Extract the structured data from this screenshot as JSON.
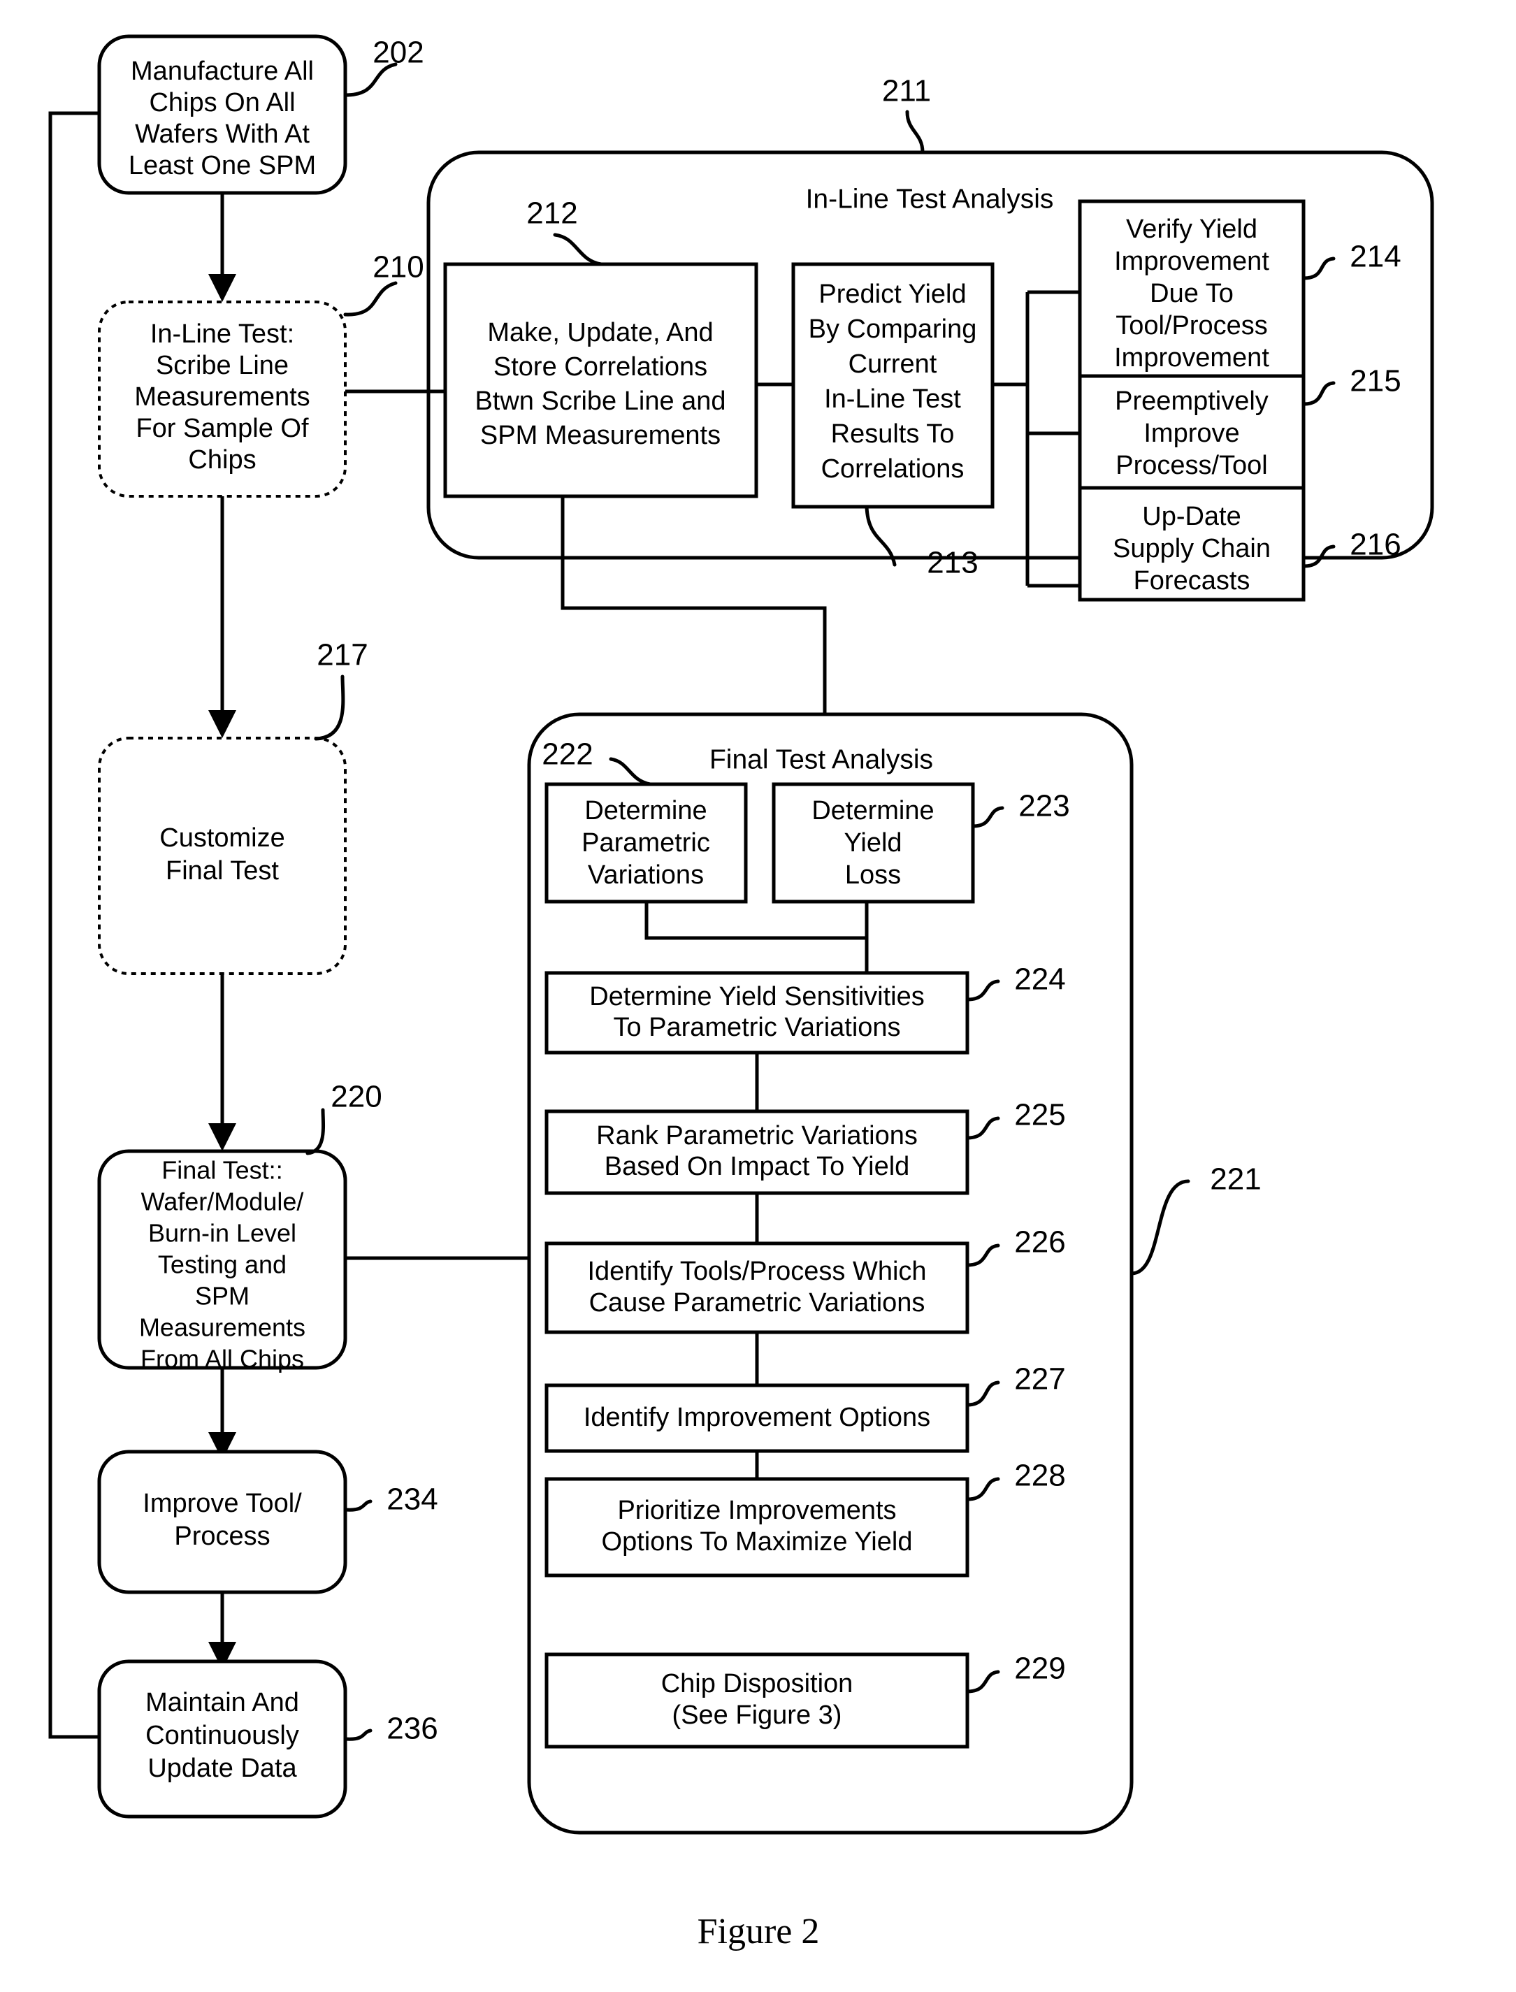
{
  "figure": {
    "caption": "Figure 2"
  },
  "process_boxes": {
    "manufacture": {
      "ref": "202",
      "lines": [
        "Manufacture All",
        "Chips On All",
        "Wafers With At",
        "Least One SPM"
      ]
    },
    "inline_test": {
      "ref": "210",
      "lines": [
        "In-Line Test:",
        "Scribe Line",
        "Measurements",
        "For Sample Of",
        "Chips"
      ]
    },
    "customize_final_test": {
      "ref": "217",
      "lines": [
        "Customize",
        "Final Test"
      ]
    },
    "final_test": {
      "ref": "220",
      "lines": [
        "Final Test::",
        "Wafer/Module/",
        "Burn-in Level",
        "Testing and",
        "SPM",
        "Measurements",
        "From All Chips"
      ]
    },
    "improve_tool_process": {
      "ref": "234",
      "lines": [
        "Improve Tool/",
        "Process"
      ]
    },
    "maintain_update_data": {
      "ref": "236",
      "lines": [
        "Maintain And",
        "Continuously",
        "Update Data"
      ]
    }
  },
  "inline_test_analysis": {
    "ref": "211",
    "title": "In-Line Test Analysis",
    "correlations": {
      "ref": "212",
      "lines": [
        "Make, Update, And",
        "Store Correlations",
        "Btwn Scribe Line and",
        "SPM Measurements"
      ]
    },
    "predict_yield": {
      "ref": "213",
      "lines": [
        "Predict Yield",
        "By Comparing",
        "Current",
        "In-Line Test",
        "Results To",
        "Correlations"
      ]
    },
    "outcomes": [
      {
        "ref": "214",
        "lines": [
          "Verify Yield",
          "Improvement",
          "Due To",
          "Tool/Process",
          "Improvement"
        ]
      },
      {
        "ref": "215",
        "lines": [
          "Preemptively",
          "Improve",
          "Process/Tool"
        ]
      },
      {
        "ref": "216",
        "lines": [
          "Up-Date",
          "Supply Chain",
          "Forecasts"
        ]
      }
    ]
  },
  "final_test_analysis": {
    "ref": "221",
    "title": "Final Test Analysis",
    "determine_parametric": {
      "ref": "222",
      "lines": [
        "Determine",
        "Parametric",
        "Variations"
      ]
    },
    "determine_yield_loss": {
      "ref": "223",
      "lines": [
        "Determine",
        "Yield",
        "Loss"
      ]
    },
    "steps": [
      {
        "ref": "224",
        "lines": [
          "Determine Yield Sensitivities",
          "To Parametric Variations"
        ]
      },
      {
        "ref": "225",
        "lines": [
          "Rank Parametric Variations",
          "Based On Impact To Yield"
        ]
      },
      {
        "ref": "226",
        "lines": [
          "Identify Tools/Process Which",
          "Cause Parametric Variations"
        ]
      },
      {
        "ref": "227",
        "lines": [
          "Identify Improvement Options"
        ]
      },
      {
        "ref": "228",
        "lines": [
          "Prioritize Improvements",
          "Options To Maximize Yield"
        ]
      },
      {
        "ref": "229",
        "lines": [
          "Chip Disposition",
          "(See Figure 3)"
        ]
      }
    ]
  }
}
